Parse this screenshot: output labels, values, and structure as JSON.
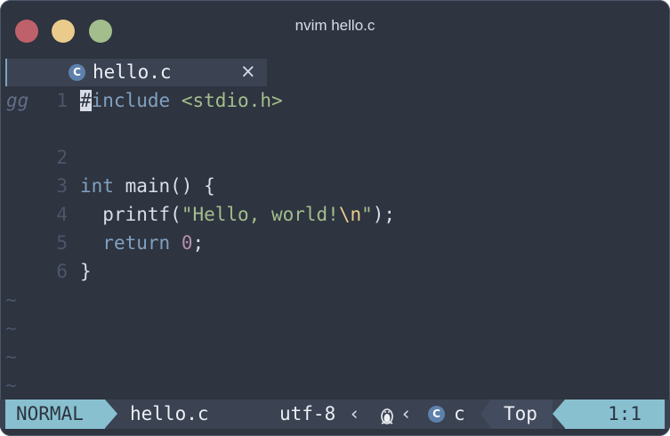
{
  "window": {
    "title": "nvim hello.c"
  },
  "tab": {
    "label": "hello.c",
    "close": "×",
    "icon": "c-language-icon"
  },
  "editor": {
    "pending_keys": "gg",
    "line_numbers": [
      "1",
      "2",
      "3",
      "4",
      "5",
      "6"
    ],
    "tilde": "~",
    "lines": {
      "l1_cursor": "#",
      "l1_directive": "include",
      "l1_header": "<stdio.h>",
      "l3_type": "int",
      "l3_rest": " main() {",
      "l4_indent": "  ",
      "l4_fn": "printf(",
      "l4_str1": "\"Hello, world!",
      "l4_esc": "\\n",
      "l4_str2": "\"",
      "l4_end": ");",
      "l5_kw": "return",
      "l5_num": "0",
      "l5_end": ";",
      "l6": "}"
    }
  },
  "statusline": {
    "mode": "NORMAL",
    "filename": "hello.c",
    "encoding": "utf-8",
    "os_icon": "linux-tux-icon",
    "filetype": "c",
    "position_label": "Top",
    "cursor_pos": "1:1",
    "separator": "‹"
  },
  "colors": {
    "background": "#2e3440",
    "accent": "#88c0d0",
    "keyword": "#81a1c1",
    "string": "#a3be8c",
    "escape": "#ebcb8b",
    "number": "#b48ead"
  }
}
